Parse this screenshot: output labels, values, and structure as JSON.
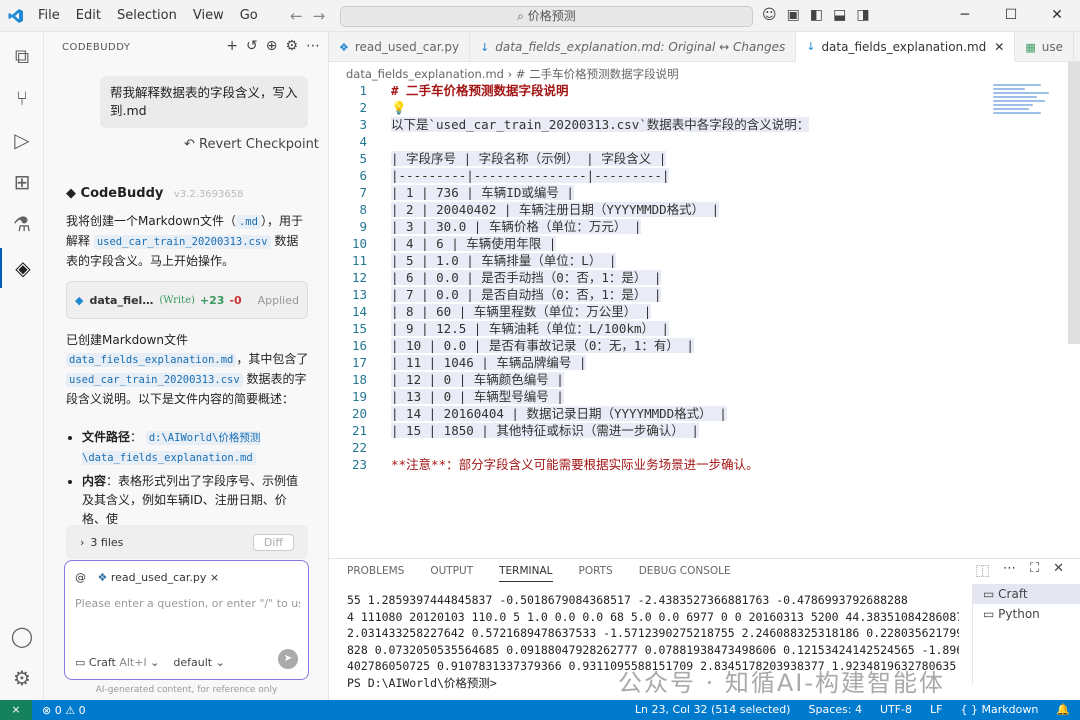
{
  "titlebar": {
    "menus": [
      "File",
      "Edit",
      "Selection",
      "View",
      "Go"
    ],
    "search": "价格预测"
  },
  "sidebar": {
    "title": "CODEBUDDY",
    "user_message": "帮我解释数据表的字段含义，写入到.md",
    "revert": "Revert Checkpoint",
    "assistant_name": "CodeBuddy",
    "version": "v3.2.3693658",
    "intro": [
      "我将创建一个Markdown文件（",
      ".md",
      "），用于解释",
      "used_car_train_20200313.csv",
      "数据表的字段含义。马上开始操作。"
    ],
    "file_card": {
      "name": "data_fiel…",
      "action": "(Write)",
      "added": "+23",
      "removed": "-0",
      "status": "Applied"
    },
    "summary": [
      "已创建Markdown文件",
      "data_fields_explanation.md",
      "，其中包含了",
      "used_car_train_20200313.csv",
      "数据表的字段含义说明。以下是文件内容的简要概述："
    ],
    "bullets": [
      {
        "label": "文件路径",
        "value": "d:\\AIWorld\\价格预测\\data_fields_explanation.md"
      },
      {
        "label": "内容",
        "value": "表格形式列出了字段序号、示例值及其含义，例如车辆ID、注册日期、价格、使"
      }
    ],
    "files_count": "3 files",
    "diff": "Diff",
    "context_file": "read_used_car.py",
    "placeholder": "Please enter a question, or enter \"/\" to use sho",
    "mode": "Craft",
    "mode_shortcut": "Alt+I",
    "model": "default",
    "disclaimer": "AI-generated content, for reference only"
  },
  "tabs": [
    {
      "label": "read_used_car.py"
    },
    {
      "label": "data_fields_explanation.md: Original ↔ Changes"
    },
    {
      "label": "data_fields_explanation.md"
    },
    {
      "label": "use"
    }
  ],
  "breadcrumb": "data_fields_explanation.md › # 二手车价格预测数据字段说明",
  "editor_lines": [
    "# 二手车价格预测数据字段说明",
    "",
    "以下是`used_car_train_20200313.csv`数据表中各字段的含义说明：",
    "",
    "| 字段序号 | 字段名称（示例） | 字段含义 |",
    "|---------|---------------|---------|",
    "| 1 | 736 | 车辆ID或编号 |",
    "| 2 | 20040402 | 车辆注册日期（YYYYMMDD格式） |",
    "| 3 | 30.0 | 车辆价格（单位：万元） |",
    "| 4 | 6 | 车辆使用年限 |",
    "| 5 | 1.0 | 车辆排量（单位：L） |",
    "| 6 | 0.0 | 是否手动挡（0：否，1：是） |",
    "| 7 | 0.0 | 是否自动挡（0：否，1：是） |",
    "| 8 | 60 | 车辆里程数（单位：万公里） |",
    "| 9 | 12.5 | 车辆油耗（单位：L/100km） |",
    "| 10 | 0.0 | 是否有事故记录（0：无，1：有） |",
    "| 11 | 1046 | 车辆品牌编号 |",
    "| 12 | 0 | 车辆颜色编号 |",
    "| 13 | 0 | 车辆型号编号 |",
    "| 14 | 20160404 | 数据记录日期（YYYYMMDD格式） |",
    "| 15 | 1850 | 其他特征或标识（需进一步确认） |",
    "",
    "**注意**：部分字段含义可能需要根据实际业务场景进一步确认。"
  ],
  "panel_tabs": [
    "PROBLEMS",
    "OUTPUT",
    "TERMINAL",
    "PORTS",
    "DEBUG CONSOLE"
  ],
  "terminal_lines": [
    "55 1.2859397444845837 -0.5018679084368517 -2.4383527366881763 -0.4786993792688288",
    "4 111080 20120103 110.0 5 1.0 0.0 0.0 68 5.0 0.0 6977 0 0 20160313 5200 44.38351084286087",
    "2.031433258227642 0.5721689478637533 -1.5712390275218755 2.246088325318186 0.2280356217997",
    "828 0.0732050535564685 0.09188047928262777 0.07881938473498606 0.12153424142524565 -1.8962",
    "402786050725 0.9107831337379366 0.9311095588151709 2.8345178203938377 1.9234819632780635",
    "PS D:\\AIWorld\\价格预测> "
  ],
  "terminal_list": [
    "Craft",
    "Python"
  ],
  "watermark": "公众号 · 知循AI-构建智能体",
  "status": {
    "errors": "0",
    "warnings": "0",
    "position": "Ln 23, Col 32 (514 selected)",
    "spaces": "Spaces: 4",
    "encoding": "UTF-8",
    "eol": "LF",
    "language": "Markdown"
  }
}
